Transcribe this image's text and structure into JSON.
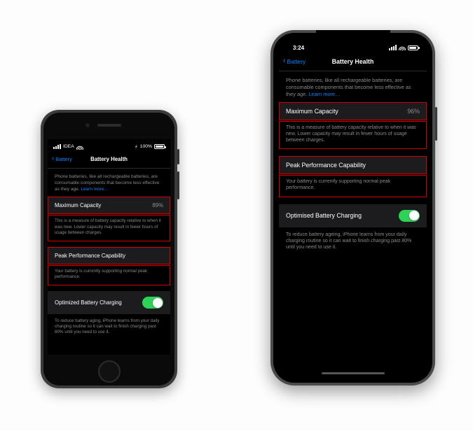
{
  "left": {
    "status": {
      "carrier": "IDEA",
      "battery_text": "100%",
      "charging_icon": "bolt"
    },
    "nav": {
      "back_label": "Battery",
      "title": "Battery Health"
    },
    "intro": "Phone batteries, like all rechargeable batteries, are consumable components that become less effective as they age.",
    "learn_more": "Learn more…",
    "max_cap": {
      "label": "Maximum Capacity",
      "value": "89%"
    },
    "max_cap_desc": "This is a measure of battery capacity relative to when it was new. Lower capacity may result in fewer hours of usage between charges.",
    "peak": {
      "label": "Peak Performance Capability"
    },
    "peak_desc": "Your battery is currently supporting normal peak performance.",
    "opt_charge": {
      "label": "Optimized Battery Charging",
      "on": "true"
    },
    "opt_desc": "To reduce battery aging, iPhone learns from your daily charging routine so it can wait to finish charging past 80% until you need to use it."
  },
  "right": {
    "status": {
      "time": "3:24"
    },
    "nav": {
      "back_label": "Battery",
      "title": "Battery Health"
    },
    "intro": "Phone batteries, like all rechargeable batteries, are consumable components that become less effective as they age.",
    "learn_more": "Learn more…",
    "max_cap": {
      "label": "Maximum Capacity",
      "value": "96%"
    },
    "max_cap_desc": "This is a measure of battery capacity relative to when it was new. Lower capacity may result in fewer hours of usage between charges.",
    "peak": {
      "label": "Peak Performance Capability"
    },
    "peak_desc": "Your battery is currently supporting normal peak performance.",
    "opt_charge": {
      "label": "Optimised Battery Charging",
      "on": "true"
    },
    "opt_desc": "To reduce battery ageing, iPhone learns from your daily charging routine so it can wait to finish charging past 80% until you need to use it."
  }
}
